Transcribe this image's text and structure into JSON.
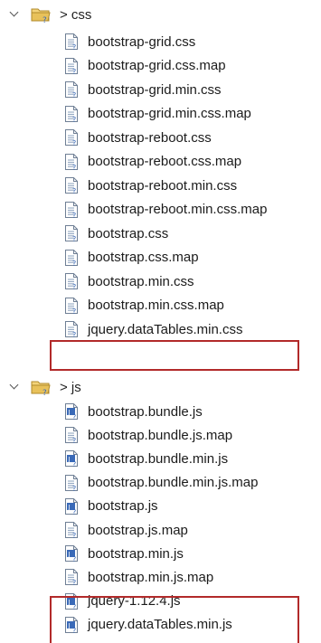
{
  "tree": {
    "css_folder": {
      "label": "> css",
      "files": [
        "bootstrap-grid.css",
        "bootstrap-grid.css.map",
        "bootstrap-grid.min.css",
        "bootstrap-grid.min.css.map",
        "bootstrap-reboot.css",
        "bootstrap-reboot.css.map",
        "bootstrap-reboot.min.css",
        "bootstrap-reboot.min.css.map",
        "bootstrap.css",
        "bootstrap.css.map",
        "bootstrap.min.css",
        "bootstrap.min.css.map",
        "jquery.dataTables.min.css"
      ]
    },
    "js_folder": {
      "label": "> js",
      "files": [
        "bootstrap.bundle.js",
        "bootstrap.bundle.js.map",
        "bootstrap.bundle.min.js",
        "bootstrap.bundle.min.js.map",
        "bootstrap.js",
        "bootstrap.js.map",
        "bootstrap.min.js",
        "bootstrap.min.js.map",
        "jquery-1.12.4.js",
        "jquery.dataTables.min.js"
      ]
    }
  },
  "icons": {
    "folder": "folder-with-unknown-icon",
    "css_file": "text-file-icon",
    "js_file": "javascript-file-icon",
    "map_file": "text-file-icon"
  },
  "colors": {
    "highlight_border": "#b22a2a",
    "folder_yellow": "#e8c15a",
    "js_file_blue": "#3a6ab8"
  }
}
